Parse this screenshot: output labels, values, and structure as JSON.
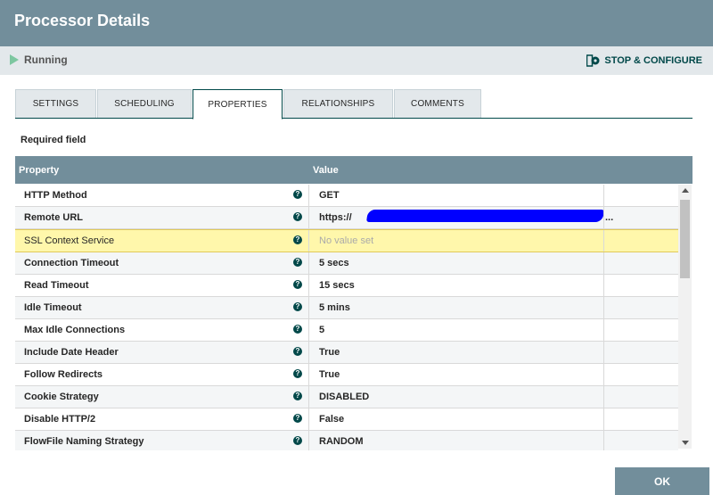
{
  "header": {
    "title": "Processor Details"
  },
  "status": {
    "label": "Running",
    "action_label": "STOP & CONFIGURE"
  },
  "tabs": [
    {
      "label": "SETTINGS"
    },
    {
      "label": "SCHEDULING"
    },
    {
      "label": "PROPERTIES",
      "active": true
    },
    {
      "label": "RELATIONSHIPS"
    },
    {
      "label": "COMMENTS"
    }
  ],
  "required_label": "Required field",
  "table": {
    "columns": {
      "property": "Property",
      "value": "Value"
    },
    "rows": [
      {
        "name": "HTTP Method",
        "value": "GET"
      },
      {
        "name": "Remote URL",
        "value": "https://"
      },
      {
        "name": "SSL Context Service",
        "value": "No value set"
      },
      {
        "name": "Connection Timeout",
        "value": "5 secs"
      },
      {
        "name": "Read Timeout",
        "value": "15 secs"
      },
      {
        "name": "Idle Timeout",
        "value": "5 mins"
      },
      {
        "name": "Max Idle Connections",
        "value": "5"
      },
      {
        "name": "Include Date Header",
        "value": "True"
      },
      {
        "name": "Follow Redirects",
        "value": "True"
      },
      {
        "name": "Cookie Strategy",
        "value": "DISABLED"
      },
      {
        "name": "Disable HTTP/2",
        "value": "False"
      },
      {
        "name": "FlowFile Naming Strategy",
        "value": "RANDOM"
      }
    ],
    "remote_url_suffix": "..."
  },
  "footer": {
    "ok_label": "OK"
  },
  "colors": {
    "header": "#728e9b",
    "accent": "#004849",
    "running": "#7dc7a0",
    "selected_row": "#fff7ab"
  },
  "icons": {
    "running": "play-icon",
    "stop_configure": "gear-icon",
    "help": "help-icon"
  }
}
